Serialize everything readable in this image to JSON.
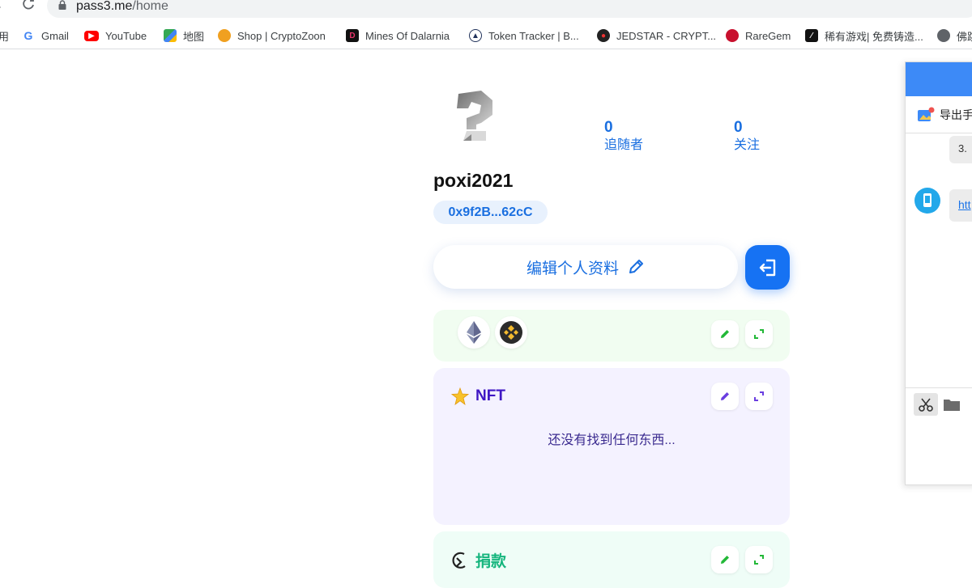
{
  "browser": {
    "url_host": "pass3.me",
    "url_path": "/home",
    "bookmarks": [
      {
        "label": "用",
        "icon": "apps-icon"
      },
      {
        "label": "Gmail",
        "icon": "google-icon"
      },
      {
        "label": "YouTube",
        "icon": "youtube-icon"
      },
      {
        "label": "地图",
        "icon": "maps-icon"
      },
      {
        "label": "Shop | CryptoZoon",
        "icon": "cryptozoon-icon"
      },
      {
        "label": "Mines Of Dalarnia",
        "icon": "dalarnia-icon"
      },
      {
        "label": "Token Tracker | B...",
        "icon": "bscscan-icon"
      },
      {
        "label": "JEDSTAR - CRYPT...",
        "icon": "jedstar-icon"
      },
      {
        "label": "RareGem",
        "icon": "raregem-icon"
      },
      {
        "label": "稀有游戏| 免费铸造...",
        "icon": "rare-game-icon"
      },
      {
        "label": "佛跳",
        "icon": "globe-icon"
      }
    ]
  },
  "profile": {
    "followers_count": "0",
    "followers_label": "追随者",
    "following_count": "0",
    "following_label": "关注",
    "username": "poxi2021",
    "address": "0x9f2B...62cC",
    "edit_label": "编辑个人资料"
  },
  "cards": {
    "nft_title": "NFT",
    "nft_empty": "还没有找到任何东西...",
    "donate_title": "捐款"
  },
  "side_panel": {
    "export_label": "导出手",
    "bubble_text": "3.",
    "link_text": "htt"
  },
  "colors": {
    "accent": "#1a6fe0",
    "logout_button": "#1672f3",
    "nft_card_bg": "#f4f2ff",
    "chain_card_bg": "#f1fdf1",
    "donate_card_bg": "#effdf7"
  }
}
